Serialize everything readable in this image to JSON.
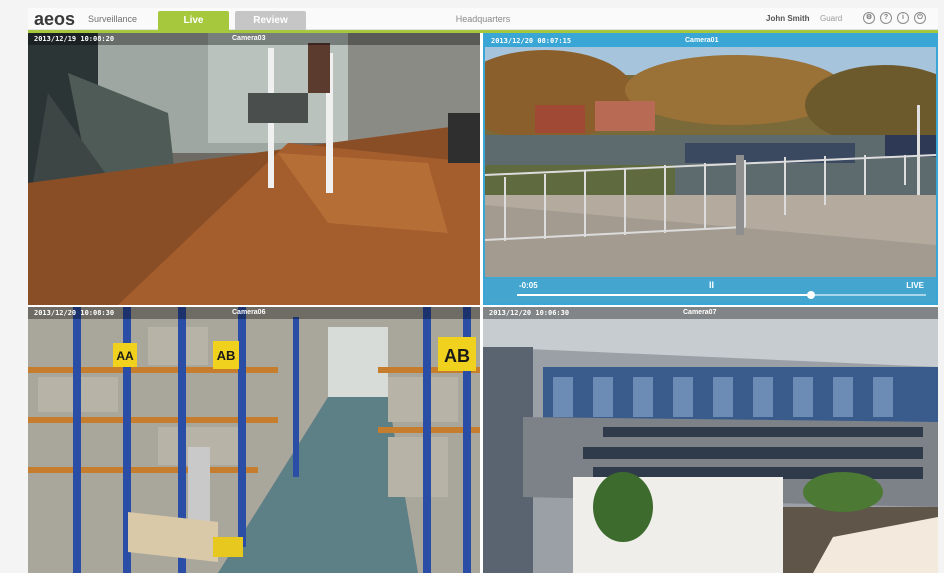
{
  "header": {
    "logo": "aeos",
    "logo_sub": "Surveillance",
    "tabs": [
      {
        "label": "Live",
        "active": true
      },
      {
        "label": "Review",
        "active": false
      }
    ],
    "location": "Headquarters",
    "user_name": "John Smith",
    "user_role": "Guard",
    "icons": [
      "settings-icon",
      "help-icon",
      "info-icon",
      "power-icon"
    ]
  },
  "colors": {
    "accent": "#a6c83c",
    "selection": "#3aa6d6"
  },
  "cameras": [
    {
      "name": "Camera03",
      "timestamp": "2013/12/19  10:08:20",
      "selected": false
    },
    {
      "name": "Camera01",
      "timestamp": "2013/12/20  08:07:15",
      "selected": true,
      "playback": {
        "time": "-0:05",
        "pause_symbol": "II",
        "live_label": "LIVE",
        "progress": 0.72
      }
    },
    {
      "name": "Camera06",
      "timestamp": "2013/12/20  10:08:30",
      "selected": false
    },
    {
      "name": "Camera07",
      "timestamp": "2013/12/20  10:06:30",
      "selected": false
    }
  ],
  "signage": {
    "aisle_labels": [
      "AA",
      "AB",
      "AB"
    ]
  }
}
